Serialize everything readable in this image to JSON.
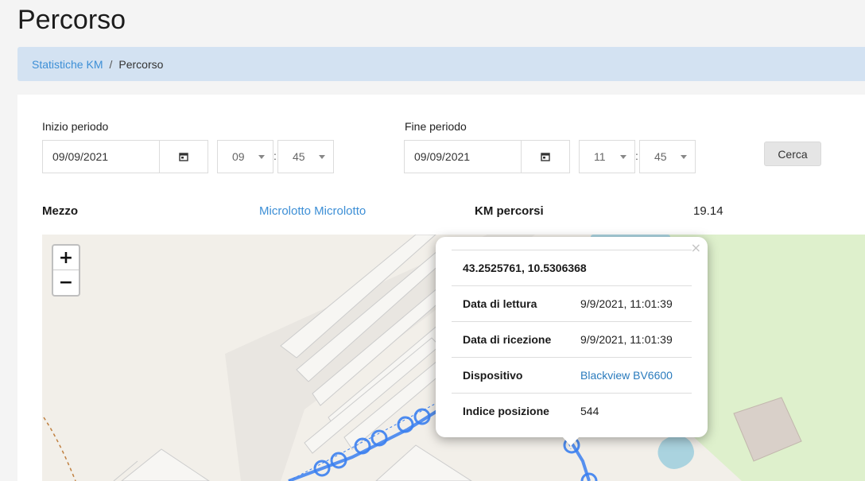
{
  "page": {
    "title": "Percorso"
  },
  "breadcrumb": {
    "parent": "Statistiche KM",
    "separator": "/",
    "current": "Percorso"
  },
  "filters": {
    "start": {
      "label": "Inizio periodo",
      "date": "09/09/2021",
      "hour": "09",
      "minute": "45"
    },
    "end": {
      "label": "Fine periodo",
      "date": "09/09/2021",
      "hour": "11",
      "minute": "45"
    },
    "time_separator": ":",
    "search_label": "Cerca"
  },
  "info": {
    "vehicle_label": "Mezzo",
    "vehicle_value": "Microlotto Microlotto",
    "km_label": "KM percorsi",
    "km_value": "19.14"
  },
  "map": {
    "zoom_in": "+",
    "zoom_out": "−",
    "popup": {
      "close": "×",
      "coords": "43.2525761, 10.5306368",
      "rows": [
        {
          "key": "Data di lettura",
          "value": "9/9/2021, 11:01:39"
        },
        {
          "key": "Data di ricezione",
          "value": "9/9/2021, 11:01:39"
        },
        {
          "key": "Dispositivo",
          "value": "Blackview BV6600"
        },
        {
          "key": "Indice posizione",
          "value": "544"
        }
      ]
    }
  },
  "colors": {
    "accent": "#3d8fd6",
    "route": "#3b7ff0",
    "breadcrumb_bg": "#d3e2f2"
  },
  "icons": {
    "calendar": "calendar-icon",
    "caret": "chevron-down-icon"
  }
}
